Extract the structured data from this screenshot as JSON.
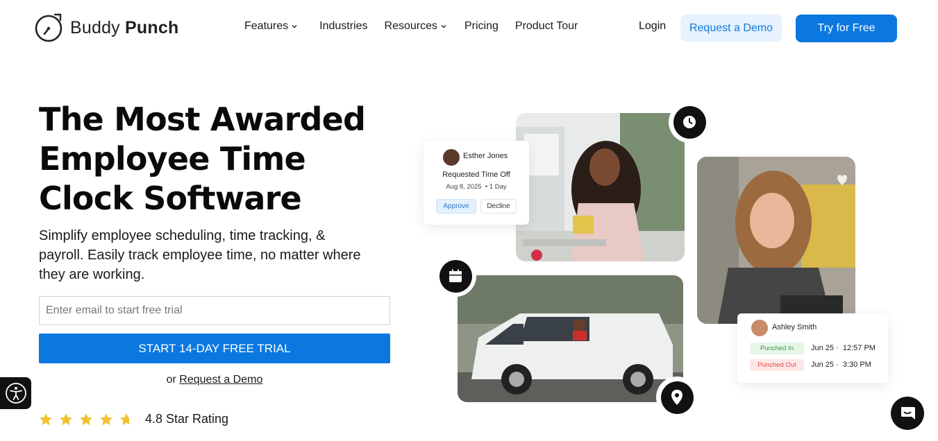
{
  "brand": {
    "name_light": "Buddy ",
    "name_bold": "Punch"
  },
  "nav": {
    "items": [
      {
        "label": "Features",
        "has_dropdown": true
      },
      {
        "label": "Industries",
        "has_dropdown": false
      },
      {
        "label": "Resources",
        "has_dropdown": true
      },
      {
        "label": "Pricing",
        "has_dropdown": false
      },
      {
        "label": "Product Tour",
        "has_dropdown": false
      }
    ],
    "login": "Login",
    "request_demo": "Request a Demo",
    "try_free": "Try for Free"
  },
  "hero": {
    "headline": "The Most Awarded Employee Time Clock Software",
    "subtext": "Simplify employee scheduling, time tracking, & payroll. Easily track employee time, no matter where they are working.",
    "email_placeholder": "Enter email to start free trial",
    "trial_button": "START 14-DAY FREE TRIAL",
    "or_text": "or ",
    "demo_link": "Request a Demo",
    "rating_text": "4.8 Star Rating",
    "rating_value": 4.8
  },
  "cards": {
    "request": {
      "name": "Esther Jones",
      "title": "Requested Time Off",
      "date": "Aug 8, 2025",
      "duration": "1 Day",
      "approve": "Approve",
      "decline": "Decline"
    },
    "punch": {
      "name": "Ashley Smith",
      "in_label": "Punched In",
      "in_date": "Jun 25",
      "in_time": "12:57 PM",
      "out_label": "Punched Out",
      "out_date": "Jun 25",
      "out_time": "3:30 PM"
    }
  },
  "colors": {
    "primary": "#0b78e0",
    "demo_bg": "#e6f2fd",
    "star": "#f2c12e",
    "punched_in": "#3a9a47",
    "punched_out": "#d6504a"
  },
  "icons": [
    "clock-icon",
    "calendar-icon",
    "map-pin-icon",
    "accessibility-icon",
    "chat-icon",
    "star-icon",
    "chevron-down-icon"
  ]
}
